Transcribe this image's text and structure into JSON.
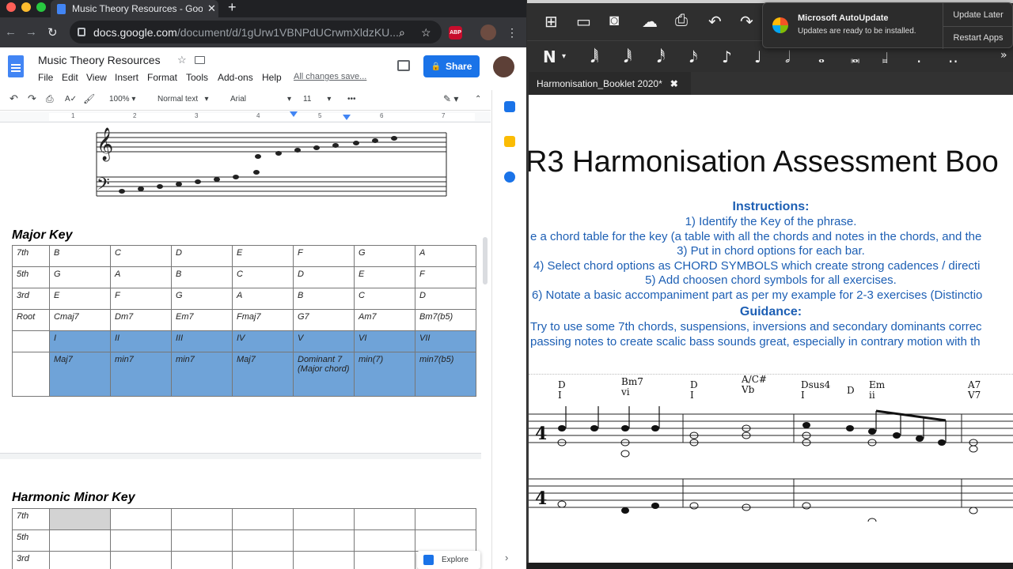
{
  "browser": {
    "tab_title": "Music Theory Resources - Goo",
    "tab_close": "✕",
    "new_tab": "+",
    "url_domain": "docs.google.com",
    "url_path": "/document/d/1gUrw1VBNPdUCrwmXldzKU...",
    "abp_label": "ABP"
  },
  "doc": {
    "title": "Music Theory Resources",
    "menu": [
      "File",
      "Edit",
      "View",
      "Insert",
      "Format",
      "Tools",
      "Add-ons",
      "Help"
    ],
    "saved_status": "All changes save...",
    "share_label": "Share",
    "toolbar": {
      "zoom": "100%",
      "style": "Normal text",
      "font": "Arial",
      "size": "11",
      "more": "•••"
    },
    "ruler_numbers": [
      "1",
      "2",
      "3",
      "4",
      "5",
      "6",
      "7"
    ],
    "major_key_heading": "Major Key",
    "major_table": [
      [
        "7th",
        "B",
        "C",
        "D",
        "E",
        "F",
        "G",
        "A"
      ],
      [
        "5th",
        "G",
        "A",
        "B",
        "C",
        "D",
        "E",
        "F"
      ],
      [
        "3rd",
        "E",
        "F",
        "G",
        "A",
        "B",
        "C",
        "D"
      ],
      [
        "Root",
        "Cmaj7",
        "Dm7",
        "Em7",
        "Fmaj7",
        "G7",
        "Am7",
        "Bm7(b5)"
      ],
      [
        "",
        "I",
        "II",
        "III",
        "IV",
        "V",
        "VI",
        "VII"
      ],
      [
        "",
        "Maj7",
        "min7",
        "min7",
        "Maj7",
        "Dominant 7 (Major chord)",
        "min(7)",
        "min7(b5)"
      ]
    ],
    "minor_key_heading": "Harmonic Minor Key",
    "minor_rows": [
      "7th",
      "5th",
      "3rd"
    ],
    "explore_label": "Explore"
  },
  "notation": {
    "tab_title": "Harmonisation_Booklet 2020*",
    "tab_close": "✖",
    "toast": {
      "title": "Microsoft AutoUpdate",
      "message": "Updates are ready to be installed.",
      "update_later": "Update Later",
      "restart_apps": "Restart Apps"
    },
    "score_title": "R3 Harmonisation Assessment Boo",
    "instructions_heading": "Instructions:",
    "instructions": [
      "1) Identify the Key of the phrase.",
      "e a chord table for the key (a table with all the chords and notes in the chords, and the",
      "3) Put in chord options for each bar.",
      "4) Select chord options as CHORD SYMBOLS which create strong cadences / directi",
      "5) Add choosen chord symbols for all exercises.",
      "6) Notate a basic accompaniment part as per my example for 2-3 exercises (Distinctio"
    ],
    "guidance_heading": "Guidance:",
    "guidance": [
      "Try to use some 7th chords, suspensions, inversions and secondary dominants correc",
      "passing notes to create scalic bass sounds great, especially in contrary motion with th"
    ],
    "chords": [
      {
        "symbol": "D",
        "numeral": "I"
      },
      {
        "symbol": "Bm7",
        "numeral": "vi"
      },
      {
        "symbol": "D",
        "numeral": "I"
      },
      {
        "symbol": "A/C#",
        "numeral": "Vb"
      },
      {
        "symbol": "Dsus4",
        "numeral": "I"
      },
      {
        "symbol": "D",
        "numeral": ""
      },
      {
        "symbol": "Em",
        "numeral": "ii"
      },
      {
        "symbol": "A7",
        "numeral": "V7"
      }
    ]
  }
}
